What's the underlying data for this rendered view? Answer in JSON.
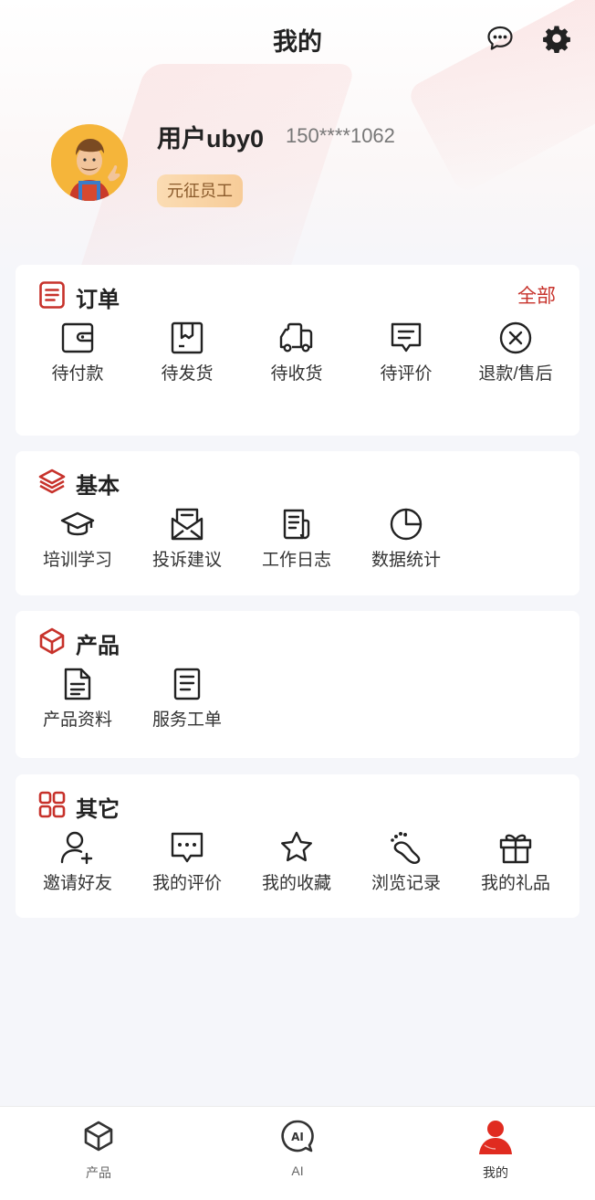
{
  "header": {
    "title": "我的"
  },
  "profile": {
    "name": "用户uby0",
    "phone": "150****1062",
    "role": "元征员工"
  },
  "sections": {
    "orders": {
      "title": "订单",
      "all_label": "全部",
      "items": [
        {
          "label": "待付款",
          "icon": "wallet-icon"
        },
        {
          "label": "待发货",
          "icon": "box-icon"
        },
        {
          "label": "待收货",
          "icon": "truck-icon"
        },
        {
          "label": "待评价",
          "icon": "comment-icon"
        },
        {
          "label": "退款/售后",
          "icon": "refund-icon"
        }
      ]
    },
    "basic": {
      "title": "基本",
      "items": [
        {
          "label": "培训学习",
          "icon": "graduation-cap-icon"
        },
        {
          "label": "投诉建议",
          "icon": "envelope-icon"
        },
        {
          "label": "工作日志",
          "icon": "journal-icon"
        },
        {
          "label": "数据统计",
          "icon": "pie-chart-icon"
        }
      ]
    },
    "product": {
      "title": "产品",
      "items": [
        {
          "label": "产品资料",
          "icon": "document-icon"
        },
        {
          "label": "服务工单",
          "icon": "clipboard-icon"
        }
      ]
    },
    "other": {
      "title": "其它",
      "items": [
        {
          "label": "邀请好友",
          "icon": "add-user-icon"
        },
        {
          "label": "我的评价",
          "icon": "chat-dots-icon"
        },
        {
          "label": "我的收藏",
          "icon": "star-icon"
        },
        {
          "label": "浏览记录",
          "icon": "footprint-icon"
        },
        {
          "label": "我的礼品",
          "icon": "gift-icon"
        }
      ]
    }
  },
  "tabbar": {
    "items": [
      {
        "label": "产品",
        "icon": "cube-icon"
      },
      {
        "label": "AI",
        "icon": "ai-chat-icon"
      },
      {
        "label": "我的",
        "icon": "person-icon",
        "active": true
      }
    ]
  },
  "colors": {
    "accent": "#c7322b",
    "badge_bg": "#f8d4a6",
    "page_bg": "#f5f6fa"
  }
}
